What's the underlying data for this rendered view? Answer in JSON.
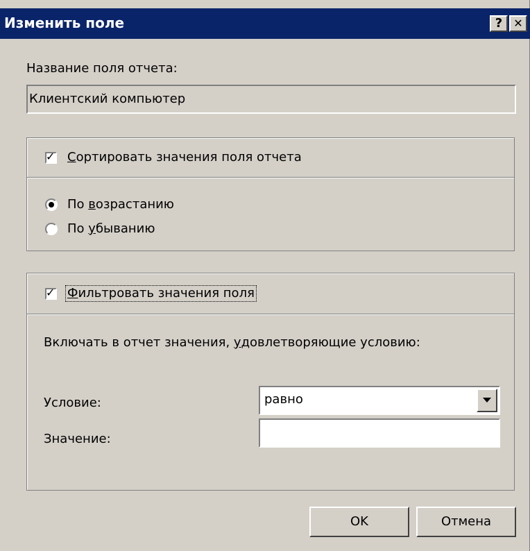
{
  "window": {
    "title": "Изменить поле",
    "help_button": "?",
    "close_button": "✕"
  },
  "report_field": {
    "label": "Название поля отчета:",
    "value": "Клиентский компьютер"
  },
  "sort": {
    "checkbox_label_mnemonic": "С",
    "checkbox_label_rest": "ортировать значения поля отчета",
    "checked": true,
    "options": [
      {
        "prefix": "По ",
        "mnemonic": "в",
        "rest": "озрастанию",
        "selected": true
      },
      {
        "prefix": "По ",
        "mnemonic": "у",
        "rest": "быванию",
        "selected": false
      }
    ]
  },
  "filter": {
    "checkbox_label_mnemonic": "Ф",
    "checkbox_label_rest": "ильтровать значения поля",
    "checked": true,
    "description_prefix": "Включать в отчет значения, ",
    "description_mnemonic": "у",
    "description_rest": "довлетворяющие условию:",
    "condition_label": "Условие:",
    "condition_value": "равно",
    "value_label": "Значение:",
    "value": ""
  },
  "buttons": {
    "ok": "OK",
    "cancel": "Отмена"
  },
  "colors": {
    "titlebar": "#0a246a",
    "face": "#d4d0c8"
  }
}
